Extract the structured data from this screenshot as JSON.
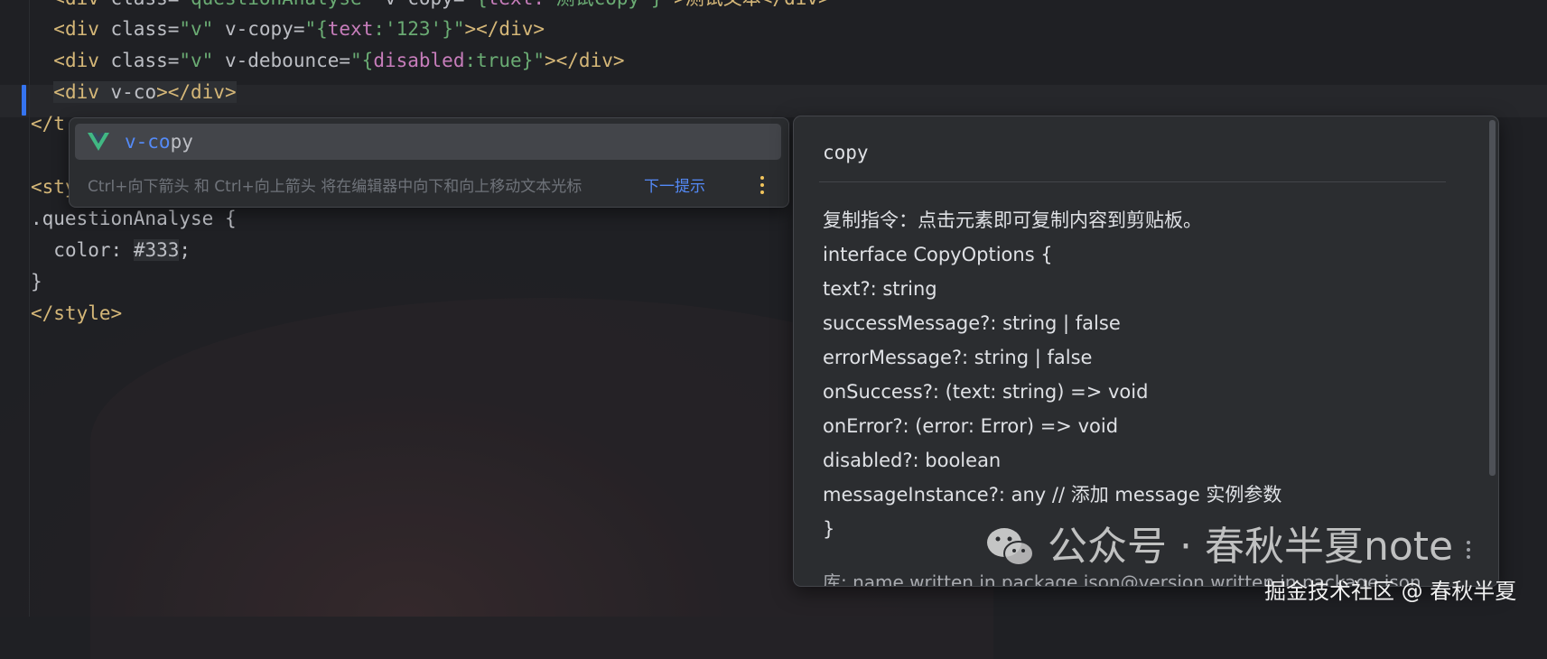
{
  "editor": {
    "lines": [
      {
        "indent": "  ",
        "parts": [
          {
            "t": "<div ",
            "c": "tag"
          },
          {
            "t": "class=",
            "c": "attr"
          },
          {
            "t": "\"questionAnalyse\"",
            "c": "str"
          },
          {
            "t": " v-copy=",
            "c": "attr"
          },
          {
            "t": "\"{",
            "c": "str"
          },
          {
            "t": "text:",
            "c": "key"
          },
          {
            "t": "'测试copy'",
            "c": "str"
          },
          {
            "t": "}\"",
            "c": "str"
          },
          {
            "t": ">测试文本</div>",
            "c": "tag"
          }
        ]
      },
      {
        "indent": "  ",
        "parts": [
          {
            "t": "<div ",
            "c": "tag"
          },
          {
            "t": "class=",
            "c": "attr"
          },
          {
            "t": "\"v\"",
            "c": "str"
          },
          {
            "t": " v-copy=",
            "c": "attr"
          },
          {
            "t": "\"{",
            "c": "str"
          },
          {
            "t": "text",
            "c": "key"
          },
          {
            "t": ":'123'}\"",
            "c": "str"
          },
          {
            "t": "></div>",
            "c": "tag"
          }
        ]
      },
      {
        "indent": "  ",
        "parts": [
          {
            "t": "<div ",
            "c": "tag"
          },
          {
            "t": "class=",
            "c": "attr"
          },
          {
            "t": "\"v\"",
            "c": "str"
          },
          {
            "t": " v-debounce=",
            "c": "attr"
          },
          {
            "t": "\"{",
            "c": "str"
          },
          {
            "t": "disabled",
            "c": "key"
          },
          {
            "t": ":true}\"",
            "c": "str"
          },
          {
            "t": "></div>",
            "c": "tag"
          }
        ]
      },
      {
        "indent": "  ",
        "parts": [
          {
            "t": "<div ",
            "c": "tag"
          },
          {
            "t": "v-co",
            "c": "attr"
          },
          {
            "t": "></div>",
            "c": "tag"
          }
        ]
      },
      {
        "indent": "",
        "parts": [
          {
            "t": "</t",
            "c": "tag"
          }
        ]
      },
      {
        "indent": "",
        "parts": []
      },
      {
        "indent": "",
        "parts": [
          {
            "t": "<style scoped>",
            "c": "tag"
          }
        ]
      },
      {
        "indent": "",
        "parts": [
          {
            "t": ".questionAnalyse",
            "c": "sel"
          },
          {
            "t": " {",
            "c": "attr"
          }
        ]
      },
      {
        "indent": "  ",
        "parts": [
          {
            "t": "color: ",
            "c": "attr"
          },
          {
            "t": "#333",
            "c": "attr"
          },
          {
            "t": ";",
            "c": "attr"
          }
        ]
      },
      {
        "indent": "",
        "parts": [
          {
            "t": "}",
            "c": "attr"
          }
        ]
      },
      {
        "indent": "",
        "parts": [
          {
            "t": "</style>",
            "c": "tag"
          }
        ]
      }
    ]
  },
  "completion": {
    "item_prefix": "v-co",
    "item_rest": "py",
    "hint": "Ctrl+向下箭头 和 Ctrl+向上箭头 将在编辑器中向下和向上移动文本光标",
    "next_hint": "下一提示",
    "icon": "vue-icon"
  },
  "doc": {
    "title": "copy",
    "lines": [
      "复制指令：点击元素即可复制内容到剪贴板。",
      "interface CopyOptions {",
      "text?: string",
      "successMessage?: string | false",
      "errorMessage?: string | false",
      "onSuccess?: (text: string) => void",
      "onError?: (error: Error) => void",
      "disabled?: boolean",
      "messageInstance?: any // 添加 message 实例参数",
      "}"
    ],
    "footer": "库: name written in package.json@version written in package.json"
  },
  "watermark": {
    "main": "公众号 · 春秋半夏note",
    "sub": "掘金技术社区 @ 春秋半夏"
  },
  "colors": {
    "tag": "#d5b778",
    "string": "#6aab73",
    "key": "#c77dbb",
    "accent": "#548af7",
    "kebab": "#f2c55c"
  }
}
